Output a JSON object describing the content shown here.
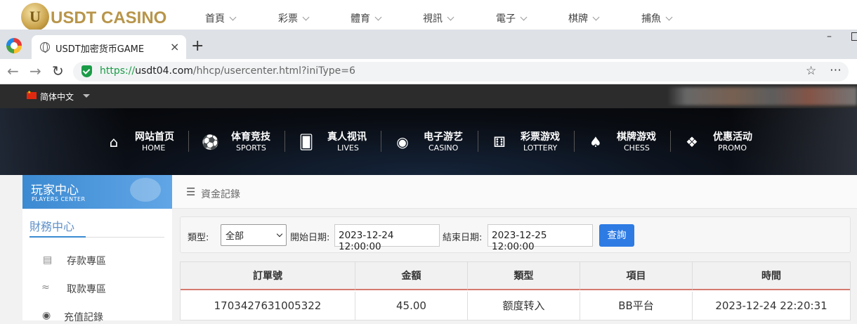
{
  "site": {
    "logo_text": "USDT CASINO",
    "logo_mark": "U",
    "top_nav": [
      "首頁",
      "彩票",
      "體育",
      "視訊",
      "電子",
      "棋牌",
      "捕魚"
    ]
  },
  "browser": {
    "tab_title": "USDT加密货币GAME",
    "url_scheme": "https://",
    "url_domain": "usdt04.com",
    "url_path": "/hhcp/usercenter.html?iniType=6",
    "new_tab": "+",
    "close": "×",
    "min": "–"
  },
  "lang": {
    "label": "简体中文"
  },
  "main_nav": [
    {
      "zh": "网站首页",
      "en": "HOME",
      "icon": "home-icon"
    },
    {
      "zh": "体育竞技",
      "en": "SPORTS",
      "icon": "ball-icon"
    },
    {
      "zh": "真人视讯",
      "en": "LIVES",
      "icon": "cards-icon"
    },
    {
      "zh": "电子游艺",
      "en": "CASINO",
      "icon": "joystick-icon"
    },
    {
      "zh": "彩票游戏",
      "en": "LOTTERY",
      "icon": "dice-icon"
    },
    {
      "zh": "棋牌游戏",
      "en": "CHESS",
      "icon": "spade-icon"
    },
    {
      "zh": "优惠活动",
      "en": "PROMO",
      "icon": "gift-icon"
    }
  ],
  "sidebar": {
    "title": "玩家中心",
    "subtitle": "PLAYERS CENTER",
    "section": "財務中心",
    "items": [
      {
        "label": "存款專區",
        "icon": "card-icon"
      },
      {
        "label": "取款專區",
        "icon": "cash-icon"
      },
      {
        "label": "充值記錄",
        "icon": "moneybag-icon"
      }
    ]
  },
  "content": {
    "breadcrumb": "資金記錄",
    "filter": {
      "type_label": "類型:",
      "type_value": "全部",
      "start_label": "開始日期:",
      "start_value": "2023-12-24 12:00:00",
      "end_label": "結束日期:",
      "end_value": "2023-12-25 12:00:00",
      "query_button": "查詢"
    },
    "table": {
      "headers": [
        "訂單號",
        "金額",
        "類型",
        "項目",
        "時間"
      ],
      "rows": [
        [
          "1703427631005322",
          "45.00",
          "额度转入",
          "BB平台",
          "2023-12-24 22:20:31"
        ]
      ]
    }
  },
  "colors": {
    "accent": "#2e7be4",
    "sidebar_head": "#3c8ad2",
    "header_underline": "#d47a6f"
  }
}
